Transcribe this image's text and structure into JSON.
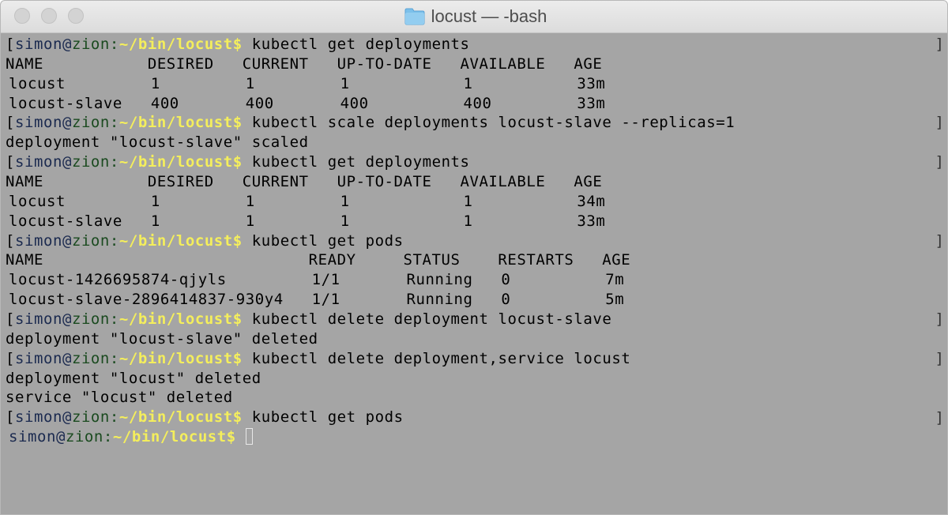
{
  "window": {
    "title": "locust — -bash",
    "folder_icon": "folder-icon"
  },
  "colors": {
    "terminal_bg": "#a5a5a5",
    "prompt_path": "#f4ee5c",
    "prompt_user": "#1b2a4f",
    "prompt_host": "#1a4a1f"
  },
  "prompt": {
    "user": "simon",
    "at": "@",
    "host": "zion",
    "colon": ":",
    "path": "~/bin/locust",
    "dollar": "$"
  },
  "lines": [
    {
      "type": "prompt",
      "cmd": " kubectl get deployments"
    },
    {
      "type": "out",
      "text": "NAME           DESIRED   CURRENT   UP-TO-DATE   AVAILABLE   AGE"
    },
    {
      "type": "out",
      "indent": true,
      "text": "locust         1         1         1            1           33m"
    },
    {
      "type": "out",
      "indent": true,
      "text": "locust-slave   400       400       400          400         33m"
    },
    {
      "type": "prompt",
      "cmd": " kubectl scale deployments locust-slave --replicas=1"
    },
    {
      "type": "out",
      "text": "deployment \"locust-slave\" scaled"
    },
    {
      "type": "prompt",
      "cmd": " kubectl get deployments"
    },
    {
      "type": "out",
      "text": "NAME           DESIRED   CURRENT   UP-TO-DATE   AVAILABLE   AGE"
    },
    {
      "type": "out",
      "indent": true,
      "text": "locust         1         1         1            1           34m"
    },
    {
      "type": "out",
      "indent": true,
      "text": "locust-slave   1         1         1            1           33m"
    },
    {
      "type": "prompt",
      "cmd": " kubectl get pods"
    },
    {
      "type": "out",
      "text": "NAME                            READY     STATUS    RESTARTS   AGE"
    },
    {
      "type": "out",
      "indent": true,
      "text": "locust-1426695874-qjyls         1/1       Running   0          7m"
    },
    {
      "type": "out",
      "indent": true,
      "text": "locust-slave-2896414837-930y4   1/1       Running   0          5m"
    },
    {
      "type": "prompt",
      "cmd": " kubectl delete deployment locust-slave"
    },
    {
      "type": "out",
      "text": "deployment \"locust-slave\" deleted"
    },
    {
      "type": "prompt",
      "cmd": " kubectl delete deployment,service locust"
    },
    {
      "type": "out",
      "text": "deployment \"locust\" deleted"
    },
    {
      "type": "out",
      "text": "service \"locust\" deleted"
    },
    {
      "type": "prompt",
      "cmd": " kubectl get pods"
    },
    {
      "type": "current",
      "cmd": " "
    }
  ]
}
